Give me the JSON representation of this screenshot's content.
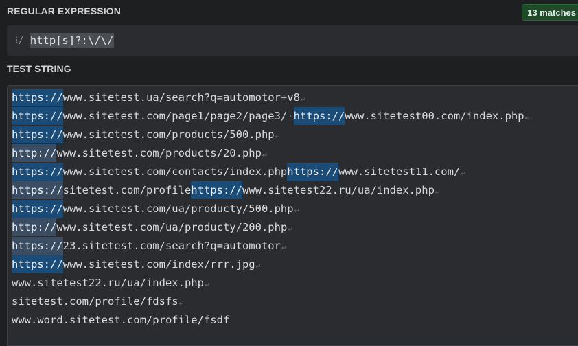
{
  "regex_section": {
    "title": "REGULAR EXPRESSION",
    "match_badge": "13 matches",
    "flag_icon": "⁝/",
    "pattern": "http[s]?:\\/\\/"
  },
  "test_section": {
    "title": "TEST STRING",
    "eol_marker": "↵",
    "space_marker": "·",
    "lines": [
      {
        "segments": [
          {
            "text": "https://",
            "match": true
          },
          {
            "text": "www.sitetest.ua/search?q=automotor+v8",
            "match": false
          }
        ],
        "eol": true
      },
      {
        "segments": [
          {
            "text": "https://",
            "match": true
          },
          {
            "text": "www.sitetest.com/page1/page2/page3/",
            "match": false
          },
          {
            "text": "·",
            "space": true
          },
          {
            "text": "https://",
            "match": true
          },
          {
            "text": "www.sitetest00.com/index.php",
            "match": false
          }
        ],
        "eol": true
      },
      {
        "segments": [
          {
            "text": "https://",
            "match": true
          },
          {
            "text": "www.sitetest.com/products/500.php",
            "match": false
          }
        ],
        "eol": true
      },
      {
        "segments": [
          {
            "text": "http://",
            "match": true,
            "alt": true
          },
          {
            "text": "www.sitetest.com/products/20.php",
            "match": false
          }
        ],
        "eol": true
      },
      {
        "segments": [
          {
            "text": "https://",
            "match": true
          },
          {
            "text": "www.sitetest.com/contacts/index.php",
            "match": false
          },
          {
            "text": "https://",
            "match": true
          },
          {
            "text": "www.sitetest11.com/",
            "match": false
          }
        ],
        "eol": true
      },
      {
        "segments": [
          {
            "text": "https://",
            "match": true,
            "alt": true
          },
          {
            "text": "sitetest.com/profile",
            "match": false
          },
          {
            "text": "https://",
            "match": true
          },
          {
            "text": "www.sitetest22.ru/ua/index.php",
            "match": false
          }
        ],
        "eol": true
      },
      {
        "segments": [
          {
            "text": "https://",
            "match": true
          },
          {
            "text": "www.sitetest.com/ua/producty/500.php",
            "match": false
          }
        ],
        "eol": true
      },
      {
        "segments": [
          {
            "text": "http://",
            "match": true,
            "alt": true
          },
          {
            "text": "www.sitetest.com/ua/producty/200.php",
            "match": false
          }
        ],
        "eol": true
      },
      {
        "segments": [
          {
            "text": "https://",
            "match": true,
            "alt": true
          },
          {
            "text": "23.sitetest.com/search?q=automotor",
            "match": false
          }
        ],
        "eol": true
      },
      {
        "segments": [
          {
            "text": "https://",
            "match": true
          },
          {
            "text": "www.sitetest.com/index/rrr.jpg",
            "match": false
          }
        ],
        "eol": true
      },
      {
        "segments": [
          {
            "text": "www.sitetest22.ru/ua/index.php",
            "match": false
          }
        ],
        "eol": true
      },
      {
        "segments": [
          {
            "text": "sitetest.com/profile/fdsfs",
            "match": false
          }
        ],
        "eol": true
      },
      {
        "segments": [
          {
            "text": "www.word.sitetest.com/profile/fsdf",
            "match": false
          }
        ],
        "eol": false
      }
    ]
  },
  "colors": {
    "background": "#1e1f21",
    "panel": "#2a2c2f",
    "match_highlight": "#1b4c78",
    "match_highlight_alt": "#3a4d62",
    "badge_bg": "#1f4a2a",
    "text": "#d8dadd"
  }
}
